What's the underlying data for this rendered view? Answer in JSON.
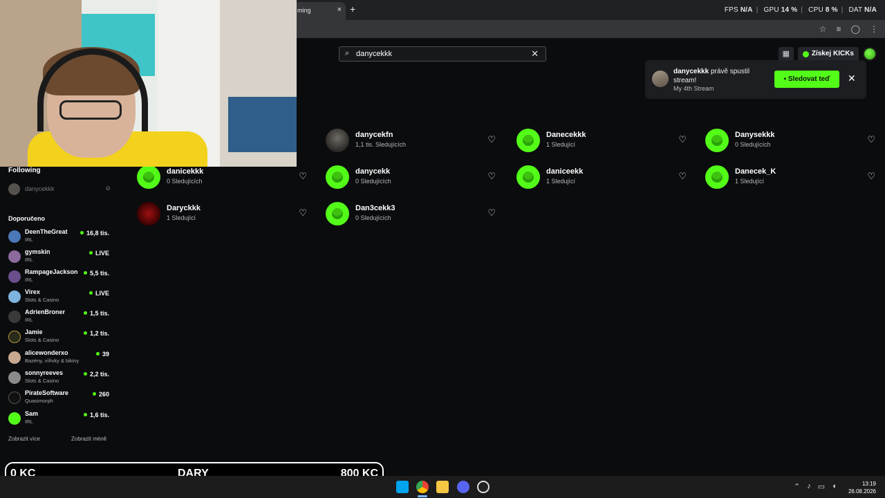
{
  "browser": {
    "tab_title": "ming",
    "tab_close": "×",
    "new_tab": "+",
    "perf": {
      "fps_label": "FPS",
      "fps_value": "N/A",
      "gpu_label": "GPU",
      "gpu_value": "14 %",
      "cpu_label": "CPU",
      "cpu_value": "8 %",
      "dat_label": "DAT",
      "dat_value": "N/A"
    },
    "address_icons": [
      "☆",
      "≡",
      "◯",
      "⋮"
    ]
  },
  "header": {
    "search_value": "danycekkk",
    "kicks_label": "Získej KICKs"
  },
  "toast": {
    "streamer": "danycekkk",
    "message": "právě spustil stream!",
    "subtitle": "My 4th Stream",
    "button_label": "Sledovat teď",
    "close": "✕"
  },
  "results": [
    {
      "name": "danycekfn",
      "followers": "1,1 tis. Sledujících",
      "avatar": "photo"
    },
    {
      "name": "Danecekkk",
      "followers": "1 Sledující",
      "avatar": "kick"
    },
    {
      "name": "Danysekkk",
      "followers": "0 Sledujících",
      "avatar": "kick"
    },
    {
      "name": "danicekkk",
      "followers": "0 Sledujících",
      "avatar": "kick"
    },
    {
      "name": "danycekk",
      "followers": "0 Sledujících",
      "avatar": "kick"
    },
    {
      "name": "daniceekk",
      "followers": "1 Sledující",
      "avatar": "kick"
    },
    {
      "name": "Danecek_K",
      "followers": "1 Sledující",
      "avatar": "kick"
    },
    {
      "name": "Daryckkk",
      "followers": "1 Sledující",
      "avatar": "red"
    },
    {
      "name": "Dan3cekk3",
      "followers": "0 Sledujících",
      "avatar": "kick"
    }
  ],
  "sidebar": {
    "following_title": "Following",
    "following": [
      {
        "name": "danycekkk"
      }
    ],
    "recommended_title": "Doporučeno",
    "recommended": [
      {
        "name": "DeenTheGreat",
        "category": "IRL",
        "viewers": "16,8 tis."
      },
      {
        "name": "gymskin",
        "category": "IRL",
        "viewers": "LIVE"
      },
      {
        "name": "RampageJackson",
        "category": "IRL",
        "viewers": "5,5 tis."
      },
      {
        "name": "Virex",
        "category": "Slots & Casino",
        "viewers": "LIVE"
      },
      {
        "name": "AdrienBroner",
        "category": "IRL",
        "viewers": "1,5 tis."
      },
      {
        "name": "Jamie",
        "category": "Slots & Casino",
        "viewers": "1,2 tis."
      },
      {
        "name": "alicewonderxo",
        "category": "Bazény, vířivky & bikiny",
        "viewers": "39"
      },
      {
        "name": "sonnyreeves",
        "category": "Slots & Casino",
        "viewers": "2,2 tis."
      },
      {
        "name": "PirateSoftware",
        "category": "Quasimorph",
        "viewers": "260"
      },
      {
        "name": "Sam",
        "category": "IRL",
        "viewers": "1,6 tis."
      }
    ],
    "show_more": "Zobrazit více",
    "show_less": "Zobrazit méně"
  },
  "donation": {
    "left": "0 KC",
    "center": "DARY",
    "right": "800 KC"
  },
  "taskbar": {
    "time": "13:19",
    "date": "26.08.2026"
  },
  "colors": {
    "accent": "#53fc18",
    "background": "#0b0c0e"
  }
}
